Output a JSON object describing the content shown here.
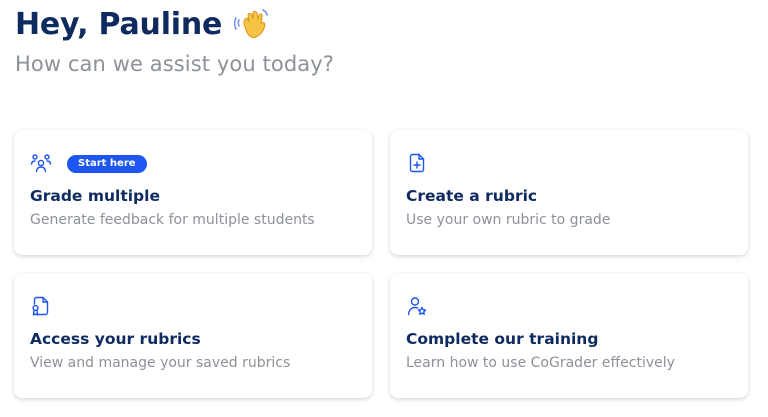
{
  "header": {
    "greeting": "Hey, Pauline",
    "greeting_emoji": "waving-hand-icon",
    "subtitle": "How can we assist you today?"
  },
  "colors": {
    "title": "#0f2a5f",
    "muted": "#8d9198",
    "accent": "#1d56f0",
    "emoji": "#f6c344"
  },
  "cards": [
    {
      "icon": "users-group-icon",
      "badge": "Start here",
      "title": "Grade multiple",
      "description": "Generate feedback for multiple students"
    },
    {
      "icon": "file-plus-icon",
      "title": "Create a rubric",
      "description": "Use your own rubric to grade"
    },
    {
      "icon": "file-badge-icon",
      "title": "Access your rubrics",
      "description": "View and manage your saved rubrics"
    },
    {
      "icon": "user-star-icon",
      "title": "Complete our training",
      "description": "Learn how to use CoGrader effectively"
    }
  ]
}
